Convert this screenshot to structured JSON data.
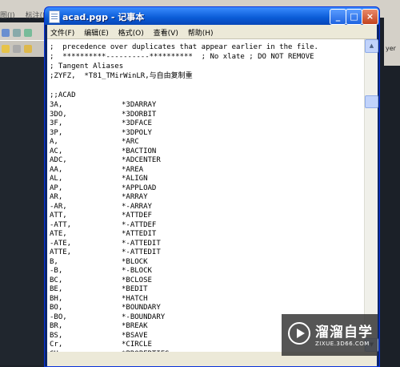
{
  "background": {
    "menu": [
      "图(I)",
      "标注(N)"
    ],
    "right_label": "yer"
  },
  "window": {
    "title": "acad.pgp - 记事本",
    "controls": {
      "minimize": "_",
      "maximize": "□",
      "close": "×"
    }
  },
  "menu": [
    "文件(F)",
    "编辑(E)",
    "格式(O)",
    "查看(V)",
    "帮助(H)"
  ],
  "editor": {
    "header_lines": [
      ";  precedence over duplicates that appear earlier in the file.",
      ";  **********----------**********  ; No xlate ; DO NOT REMOVE",
      "; Tangent Aliases",
      ";ZYFZ,  *T81_TMirWinLR,与自由复制重",
      "",
      ";;ACAD"
    ],
    "aliases": [
      {
        "alias": "3A,",
        "command": "*3DARRAY"
      },
      {
        "alias": "3DO,",
        "command": "*3DORBIT"
      },
      {
        "alias": "3F,",
        "command": "*3DFACE"
      },
      {
        "alias": "3P,",
        "command": "*3DPOLY"
      },
      {
        "alias": "A,",
        "command": "*ARC"
      },
      {
        "alias": "AC,",
        "command": "*BACTION"
      },
      {
        "alias": "ADC,",
        "command": "*ADCENTER"
      },
      {
        "alias": "AA,",
        "command": "*AREA"
      },
      {
        "alias": "AL,",
        "command": "*ALIGN"
      },
      {
        "alias": "AP,",
        "command": "*APPLOAD"
      },
      {
        "alias": "AR,",
        "command": "*ARRAY"
      },
      {
        "alias": "-AR,",
        "command": "*-ARRAY"
      },
      {
        "alias": "ATT,",
        "command": "*ATTDEF"
      },
      {
        "alias": "-ATT,",
        "command": "*-ATTDEF"
      },
      {
        "alias": "ATE,",
        "command": "*ATTEDIT"
      },
      {
        "alias": "-ATE,",
        "command": "*-ATTEDIT"
      },
      {
        "alias": "ATTE,",
        "command": "*-ATTEDIT"
      },
      {
        "alias": "B,",
        "command": "*BLOCK"
      },
      {
        "alias": "-B,",
        "command": "*-BLOCK"
      },
      {
        "alias": "BC,",
        "command": "*BCLOSE"
      },
      {
        "alias": "BE,",
        "command": "*BEDIT"
      },
      {
        "alias": "BH,",
        "command": "*HATCH"
      },
      {
        "alias": "BO,",
        "command": "*BOUNDARY"
      },
      {
        "alias": "-BO,",
        "command": "*-BOUNDARY"
      },
      {
        "alias": "BR,",
        "command": "*BREAK"
      },
      {
        "alias": "BS,",
        "command": "*BSAVE"
      },
      {
        "alias": "Cr,",
        "command": "*CIRCLE"
      },
      {
        "alias": "CH,",
        "command": "*PROPERTIES"
      }
    ]
  },
  "watermark": {
    "brand": "溜溜自学",
    "url": "ZIXUE.3D66.COM"
  }
}
